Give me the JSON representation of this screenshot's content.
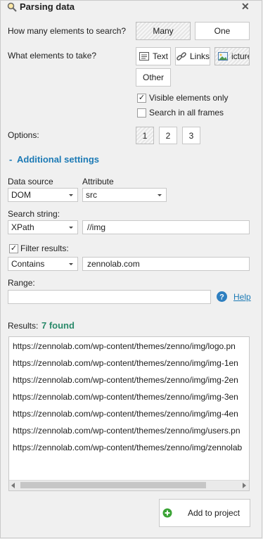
{
  "header": {
    "title": "Parsing data"
  },
  "count": {
    "label": "How many elements to search?",
    "many": "Many",
    "one": "One"
  },
  "take": {
    "label": "What elements to take?",
    "text": "Text",
    "links": "Links",
    "picture": "icture",
    "other": "Other",
    "visible_only": "Visible elements only",
    "all_frames": "Search in all frames"
  },
  "options": {
    "label": "Options:",
    "b1": "1",
    "b2": "2",
    "b3": "3"
  },
  "additional": {
    "toggle": "-",
    "label": "Additional settings"
  },
  "source": {
    "label": "Data source",
    "value": "DOM"
  },
  "attribute": {
    "label": "Attribute",
    "value": "src"
  },
  "search": {
    "label": "Search string:",
    "type": "XPath",
    "value": "//img"
  },
  "filter": {
    "label": "Filter results:",
    "mode": "Contains",
    "value": "zennolab.com"
  },
  "range": {
    "label": "Range:",
    "value": "",
    "help": "Help"
  },
  "results": {
    "label": "Results:",
    "count": "7 found",
    "items": [
      "https://zennolab.com/wp-content/themes/zenno/img/logo.pn",
      "https://zennolab.com/wp-content/themes/zenno/img/img-1en",
      "https://zennolab.com/wp-content/themes/zenno/img/img-2en",
      "https://zennolab.com/wp-content/themes/zenno/img/img-3en",
      "https://zennolab.com/wp-content/themes/zenno/img/img-4en",
      "https://zennolab.com/wp-content/themes/zenno/img/users.pn",
      "https://zennolab.com/wp-content/themes/zenno/img/zennolab"
    ]
  },
  "add": {
    "label": "Add to project"
  },
  "colors": {
    "accent": "#1c7ab5",
    "found": "#2a8a6a"
  }
}
